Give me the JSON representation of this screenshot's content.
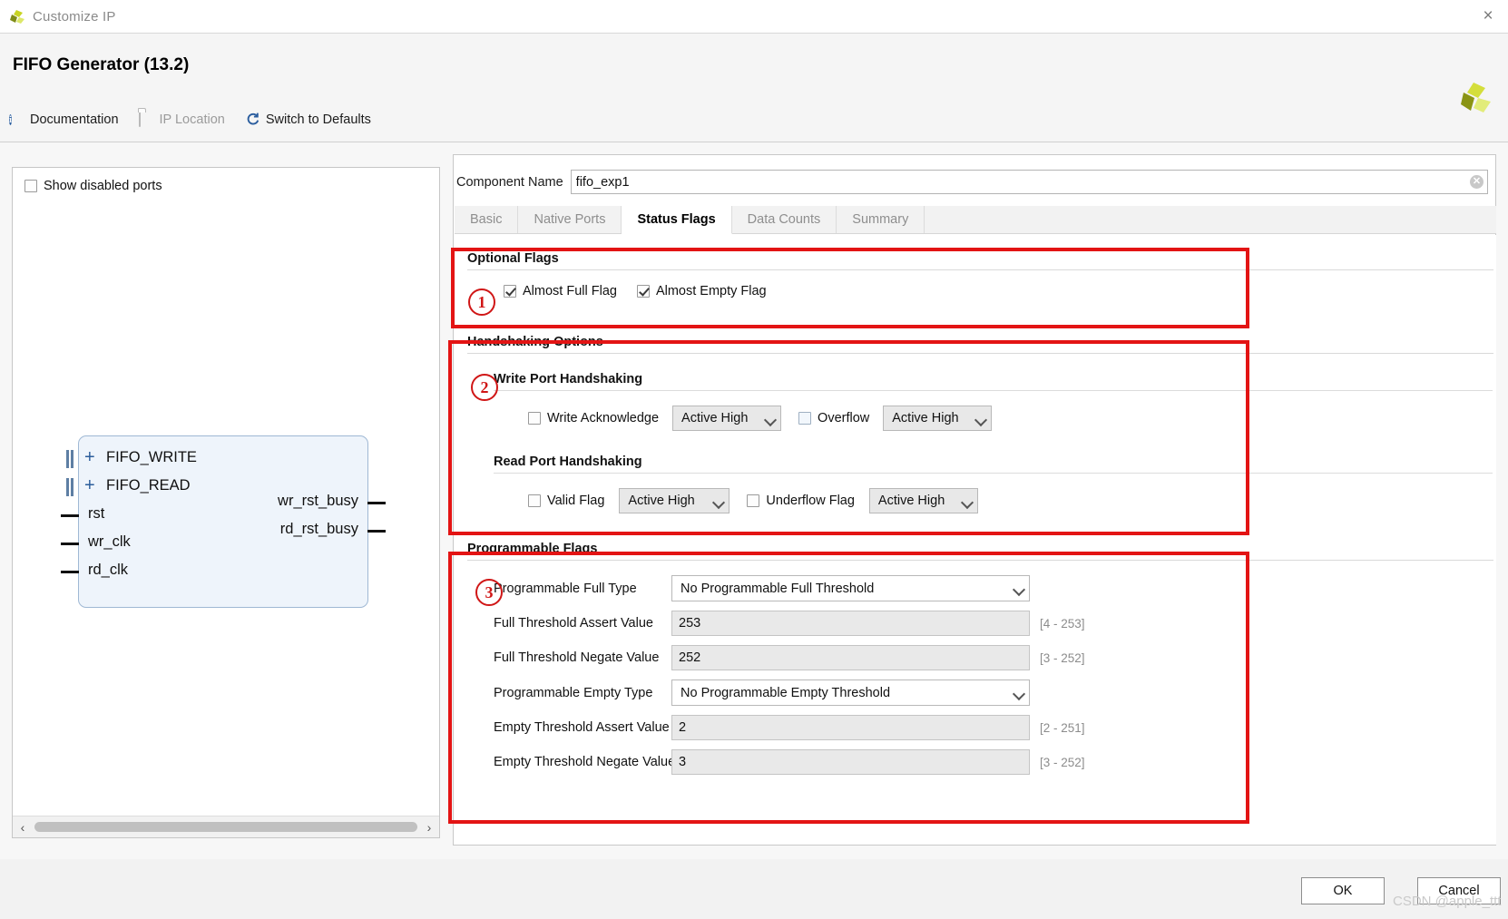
{
  "window": {
    "title": "Customize IP",
    "close_label": "×",
    "logo_icon": "xilinx-logo-icon"
  },
  "header": {
    "title": "FIFO Generator (13.2)",
    "links": [
      {
        "label": "Documentation",
        "icon": "info-icon",
        "disabled": false
      },
      {
        "label": "IP Location",
        "icon": "folder-icon",
        "disabled": true
      },
      {
        "label": "Switch to Defaults",
        "icon": "refresh-icon",
        "disabled": false
      }
    ]
  },
  "left_panel": {
    "show_disabled_ports": {
      "label": "Show disabled ports",
      "checked": false
    },
    "diagram": {
      "bus_ports": [
        "FIFO_WRITE",
        "FIFO_READ"
      ],
      "input_ports": [
        "rst",
        "wr_clk",
        "rd_clk"
      ],
      "output_ports": [
        "wr_rst_busy",
        "rd_rst_busy"
      ]
    },
    "scrollbar": {
      "left_arrow": "‹",
      "right_arrow": "›"
    }
  },
  "component": {
    "name_label": "Component Name",
    "name_value": "fifo_exp1",
    "clear_icon": "clear-circle-icon"
  },
  "tabs": [
    {
      "label": "Basic",
      "active": false
    },
    {
      "label": "Native Ports",
      "active": false
    },
    {
      "label": "Status Flags",
      "active": true
    },
    {
      "label": "Data Counts",
      "active": false
    },
    {
      "label": "Summary",
      "active": false
    }
  ],
  "optional_flags": {
    "title": "Optional Flags",
    "items": [
      {
        "label": "Almost Full Flag",
        "checked": true
      },
      {
        "label": "Almost Empty Flag",
        "checked": true
      }
    ]
  },
  "handshaking": {
    "title": "Handshaking Options",
    "write": {
      "title": "Write Port Handshaking",
      "fields": [
        {
          "label": "Write Acknowledge",
          "checked": false,
          "select": "Active High"
        },
        {
          "label": "Overflow",
          "checked": false,
          "select": "Active High"
        }
      ]
    },
    "read": {
      "title": "Read Port Handshaking",
      "fields": [
        {
          "label": "Valid Flag",
          "checked": false,
          "select": "Active High"
        },
        {
          "label": "Underflow Flag",
          "checked": false,
          "select": "Active High"
        }
      ]
    }
  },
  "programmable_flags": {
    "title": "Programmable Flags",
    "full_type": {
      "label": "Programmable Full Type",
      "value": "No Programmable Full Threshold"
    },
    "full_assert": {
      "label": "Full Threshold Assert Value",
      "value": "253",
      "range": "[4 - 253]"
    },
    "full_negate": {
      "label": "Full Threshold Negate Value",
      "value": "252",
      "range": "[3 - 252]"
    },
    "empty_type": {
      "label": "Programmable Empty Type",
      "value": "No Programmable Empty Threshold"
    },
    "empty_assert": {
      "label": "Empty Threshold Assert Value",
      "value": "2",
      "range": "[2 - 251]"
    },
    "empty_negate": {
      "label": "Empty Threshold Negate Value",
      "value": "3",
      "range": "[3 - 252]"
    }
  },
  "annotations": {
    "markers": [
      "①",
      "②",
      "③"
    ],
    "numbers": [
      "1",
      "2",
      "3"
    ],
    "color": "#e31414"
  },
  "footer": {
    "ok_label": "OK",
    "cancel_label": "Cancel"
  },
  "watermark": "CSDN @apple_ttt"
}
